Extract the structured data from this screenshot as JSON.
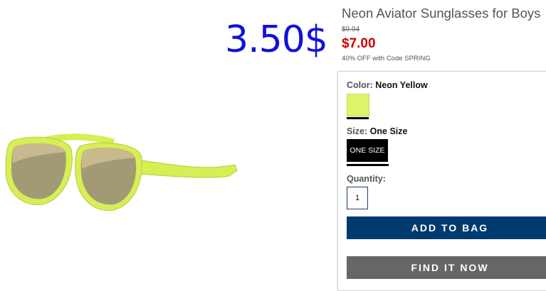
{
  "overlay": {
    "price_text": "3.50$"
  },
  "product": {
    "title": "Neon Aviator Sunglasses for Boys",
    "original_price": "$9.94",
    "sale_price": "$7.00",
    "promo": "40% OFF with Code SPRING"
  },
  "options": {
    "color_label": "Color:",
    "color_value": "Neon Yellow",
    "size_label": "Size:",
    "size_value": "One Size",
    "size_button": "ONE SIZE",
    "quantity_label": "Quantity:",
    "quantity_value": "1"
  },
  "actions": {
    "add_to_bag": "ADD TO BAG",
    "find_it_now": "FIND IT NOW"
  },
  "colors": {
    "overlay_price": "#1010e0",
    "sale_price": "#cc0000",
    "add_button": "#003b6f",
    "find_button": "#666666",
    "swatch": "#dcf36a"
  }
}
